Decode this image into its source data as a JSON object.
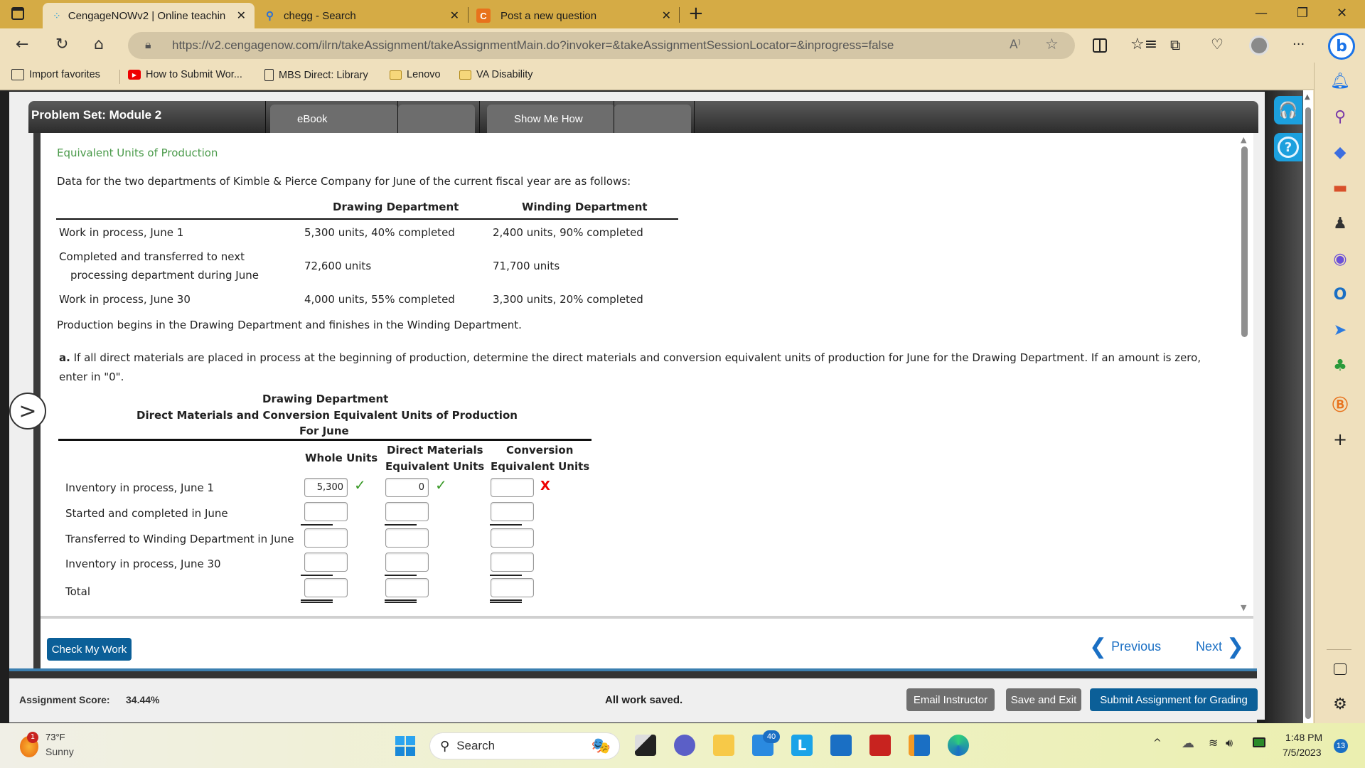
{
  "browser": {
    "tabs": [
      {
        "label": "CengageNOWv2 | Online teachin",
        "icon": "cengage-loading-icon",
        "active": true
      },
      {
        "label": "chegg - Search",
        "icon": "search-icon",
        "active": false
      },
      {
        "label": "Post a new question",
        "icon": "chegg-c-icon",
        "active": false
      }
    ],
    "new_tab_glyph": "+",
    "close_glyph": "✕",
    "window": {
      "minimize": "—",
      "restore": "❐",
      "close": "✕"
    },
    "url": "https://v2.cengagenow.com/ilrn/takeAssignment/takeAssignmentMain.do?invoker=&takeAssignmentSessionLocator=&inprogress=false",
    "nav": {
      "back": "←",
      "refresh": "↻",
      "home": "⌂"
    },
    "toolbar_icons": [
      "read-aloud-icon",
      "favorite-star-icon",
      "split-screen-icon",
      "favorites-icon",
      "collections-icon",
      "browser-essentials-icon",
      "profile-icon",
      "more-icon",
      "bing-icon"
    ],
    "read_aloud": "A⁾",
    "more": "···",
    "bookmarks": [
      {
        "label": "Import favorites",
        "icon": "import-icon"
      },
      {
        "label": "How to Submit Wor...",
        "icon": "youtube-icon"
      },
      {
        "label": "MBS Direct: Library",
        "icon": "page-icon"
      },
      {
        "label": "Lenovo",
        "icon": "folder-icon"
      },
      {
        "label": "VA Disability",
        "icon": "folder-icon"
      }
    ]
  },
  "app": {
    "title": "Problem Set: Module 2",
    "header_buttons": [
      "eBook",
      "Show Me How"
    ],
    "section_title": "Equivalent Units of Production",
    "intro": "Data for the two departments of Kimble & Pierce Company for June of the current fiscal year are as follows:",
    "data_table": {
      "headers": [
        "",
        "Drawing Department",
        "Winding Department"
      ],
      "rows": [
        {
          "label": "Work in process, June 1",
          "label2": "",
          "drawing": "5,300 units, 40% completed",
          "winding": "2,400 units, 90% completed"
        },
        {
          "label": "Completed and transferred to next",
          "label2": "processing department during June",
          "drawing": "72,600 units",
          "winding": "71,700 units"
        },
        {
          "label": "Work in process, June 30",
          "label2": "",
          "drawing": "4,000 units, 55% completed",
          "winding": "3,300 units, 20% completed"
        }
      ]
    },
    "production_note": "Production begins in the Drawing Department and finishes in the Winding Department.",
    "question_prefix": "a.",
    "question_line1": "If all direct materials are placed in process at the beginning of production, determine the direct materials and conversion equivalent units of production for June for the Drawing Department. If an amount is zero,",
    "question_line2": "enter in \"0\".",
    "answer_table": {
      "title1": "Drawing Department",
      "title2": "Direct Materials and Conversion Equivalent Units of Production",
      "title3": "For June",
      "col_whole": "Whole Units",
      "col_dm_1": "Direct Materials",
      "col_dm_2": "Equivalent Units",
      "col_conv_1": "Conversion",
      "col_conv_2": "Equivalent Units",
      "rows": [
        {
          "label": "Inventory in process, June 1",
          "whole": "5,300",
          "whole_status": "correct",
          "dm": "0",
          "dm_status": "correct",
          "conv": "",
          "conv_status": "incorrect"
        },
        {
          "label": "Started and completed in June",
          "whole": "",
          "dm": "",
          "conv": ""
        },
        {
          "label": "Transferred to Winding Department in June",
          "whole": "",
          "dm": "",
          "conv": ""
        },
        {
          "label": "Inventory in process, June 30",
          "whole": "",
          "dm": "",
          "conv": ""
        },
        {
          "label": "Total",
          "whole": "",
          "dm": "",
          "conv": ""
        }
      ],
      "correct_glyph": "✓",
      "incorrect_glyph": "X"
    },
    "check_my_work": "Check My Work",
    "previous": "Previous",
    "next": "Next",
    "prev_glyph": "❮",
    "next_glyph": "❯",
    "expand_glyph": ">",
    "assignment_score_label": "Assignment Score:",
    "assignment_score": "34.44%",
    "save_status": "All work saved.",
    "email_instructor": "Email Instructor",
    "save_and_exit": "Save and Exit",
    "submit": "Submit Assignment for Grading",
    "support_glyph": "🎧",
    "help_glyph": "?"
  },
  "edge_sidebar": {
    "icons": [
      "notification-bell-icon",
      "search-icon",
      "shopping-tag-icon",
      "tools-icon",
      "games-icon",
      "office-icon",
      "outlook-icon",
      "drop-icon",
      "tree-icon",
      "b-icon",
      "add-icon"
    ],
    "add_glyph": "+",
    "settings_glyph": "⚙"
  },
  "taskbar": {
    "weather_temp": "73°F",
    "weather_desc": "Sunny",
    "weather_badge": "1",
    "search_label": "Search",
    "mail_badge": "40",
    "time": "1:48 PM",
    "date": "7/5/2023",
    "notification_count": "13"
  },
  "colors": {
    "accent_blue": "#0b5f98",
    "section_green": "#4a9a4a",
    "correct_green": "#3a9a28",
    "incorrect_red": "#e00000",
    "titlebar": "#d5ab45"
  }
}
